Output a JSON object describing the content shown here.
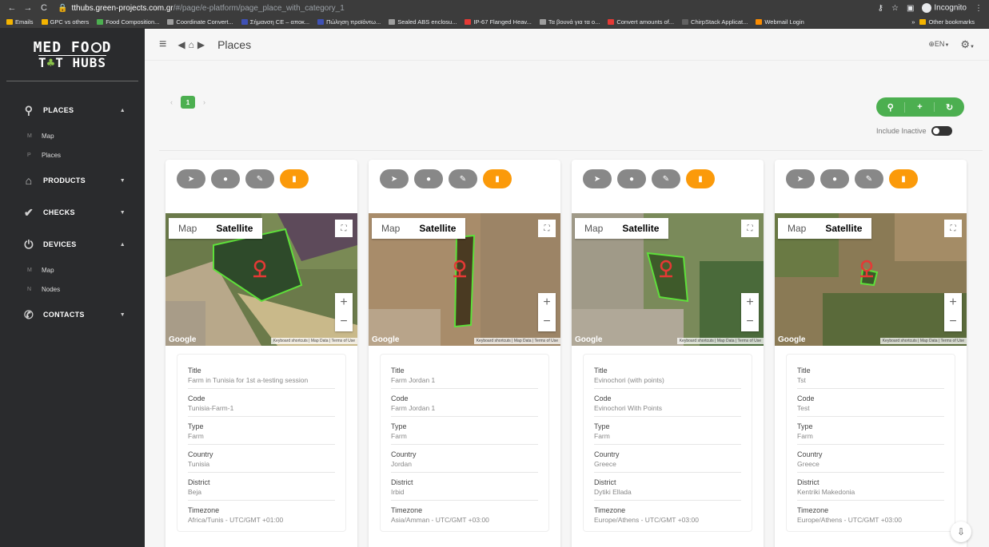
{
  "browser": {
    "url_host": "tthubs.green-projects.com.gr",
    "url_path": "/#/page/e-platform/page_place_with_category_1",
    "incognito_label": "Incognito",
    "bookmarks": [
      {
        "label": "Emails",
        "color": "#f4b400"
      },
      {
        "label": "GPC vs others",
        "color": "#f4b400"
      },
      {
        "label": "Food Composition...",
        "color": "#4caf50"
      },
      {
        "label": "Coordinate Convert...",
        "color": "#9e9e9e"
      },
      {
        "label": "Σήμανση CE – αποκ...",
        "color": "#3f51b5"
      },
      {
        "label": "Πώληση προϊόντω...",
        "color": "#3f51b5"
      },
      {
        "label": "Sealed ABS enclosu...",
        "color": "#9e9e9e"
      },
      {
        "label": "IP-67 Flanged Heav...",
        "color": "#e53935"
      },
      {
        "label": "Τα βουνά για τα ο...",
        "color": "#9e9e9e"
      },
      {
        "label": "Convert amounts of...",
        "color": "#e53935"
      },
      {
        "label": "ChirpStack Applicat...",
        "color": "#616161"
      },
      {
        "label": "Webmail Login",
        "color": "#fb8c00"
      }
    ],
    "other_bookmarks": "Other bookmarks",
    "more": "»"
  },
  "sidebar": {
    "logo_line1": "MED FO",
    "logo_line1_end": "D",
    "logo_line2_a": "T",
    "logo_line2_b": "T HUBS",
    "menu": [
      {
        "label": "PLACES",
        "icon": "map-pin-icon",
        "glyph": "⚲",
        "caret": "▲",
        "subs": [
          {
            "k": "M",
            "label": "Map"
          },
          {
            "k": "P",
            "label": "Places"
          }
        ]
      },
      {
        "label": "PRODUCTS",
        "icon": "barn-icon",
        "glyph": "⌂",
        "caret": "▼",
        "subs": []
      },
      {
        "label": "CHECKS",
        "icon": "check-icon",
        "glyph": "✔",
        "caret": "▼",
        "subs": []
      },
      {
        "label": "DEVICES",
        "icon": "power-icon",
        "glyph": "⏻",
        "caret": "▲",
        "subs": [
          {
            "k": "M",
            "label": "Map"
          },
          {
            "k": "N",
            "label": "Nodes"
          }
        ]
      },
      {
        "label": "CONTACTS",
        "icon": "phone-icon",
        "glyph": "✆",
        "caret": "▼",
        "subs": []
      }
    ]
  },
  "topbar": {
    "title": "Places",
    "language": "EN"
  },
  "pager": {
    "current": "1",
    "prev": "‹",
    "next": "›"
  },
  "filters": {
    "include_inactive": "Include Inactive"
  },
  "map_labels": {
    "map": "Map",
    "satellite": "Satellite",
    "google": "Google",
    "attribution": "Keyboard shortcuts | Map Data | Terms of Use"
  },
  "field_labels": {
    "title": "Title",
    "code": "Code",
    "type": "Type",
    "country": "Country",
    "district": "District",
    "timezone": "Timezone"
  },
  "places": [
    {
      "title": "Farm in Tunisia for 1st a-testing session",
      "code": "Tunisia-Farm-1",
      "type": "Farm",
      "country": "Tunisia",
      "district": "Beja",
      "timezone": "Africa/Tunis - UTC/GMT +01:00"
    },
    {
      "title": "Farm Jordan 1",
      "code": "Farm Jordan 1",
      "type": "Farm",
      "country": "Jordan",
      "district": "Irbid",
      "timezone": "Asia/Amman - UTC/GMT +03:00"
    },
    {
      "title": "Evinochori (with points)",
      "code": "Evinochori With Points",
      "type": "Farm",
      "country": "Greece",
      "district": "Dytiki Ellada",
      "timezone": "Europe/Athens - UTC/GMT +03:00"
    },
    {
      "title": "Tst",
      "code": "Test",
      "type": "Farm",
      "country": "Greece",
      "district": "Kentriki Makedonia",
      "timezone": "Europe/Athens - UTC/GMT +03:00"
    }
  ],
  "colors": {
    "accent_green": "#4caf50",
    "orange": "#fb9a0a",
    "sidebar_bg": "#2a2b2d",
    "boundary_green": "#5ee03a",
    "marker_red": "#e53935"
  }
}
